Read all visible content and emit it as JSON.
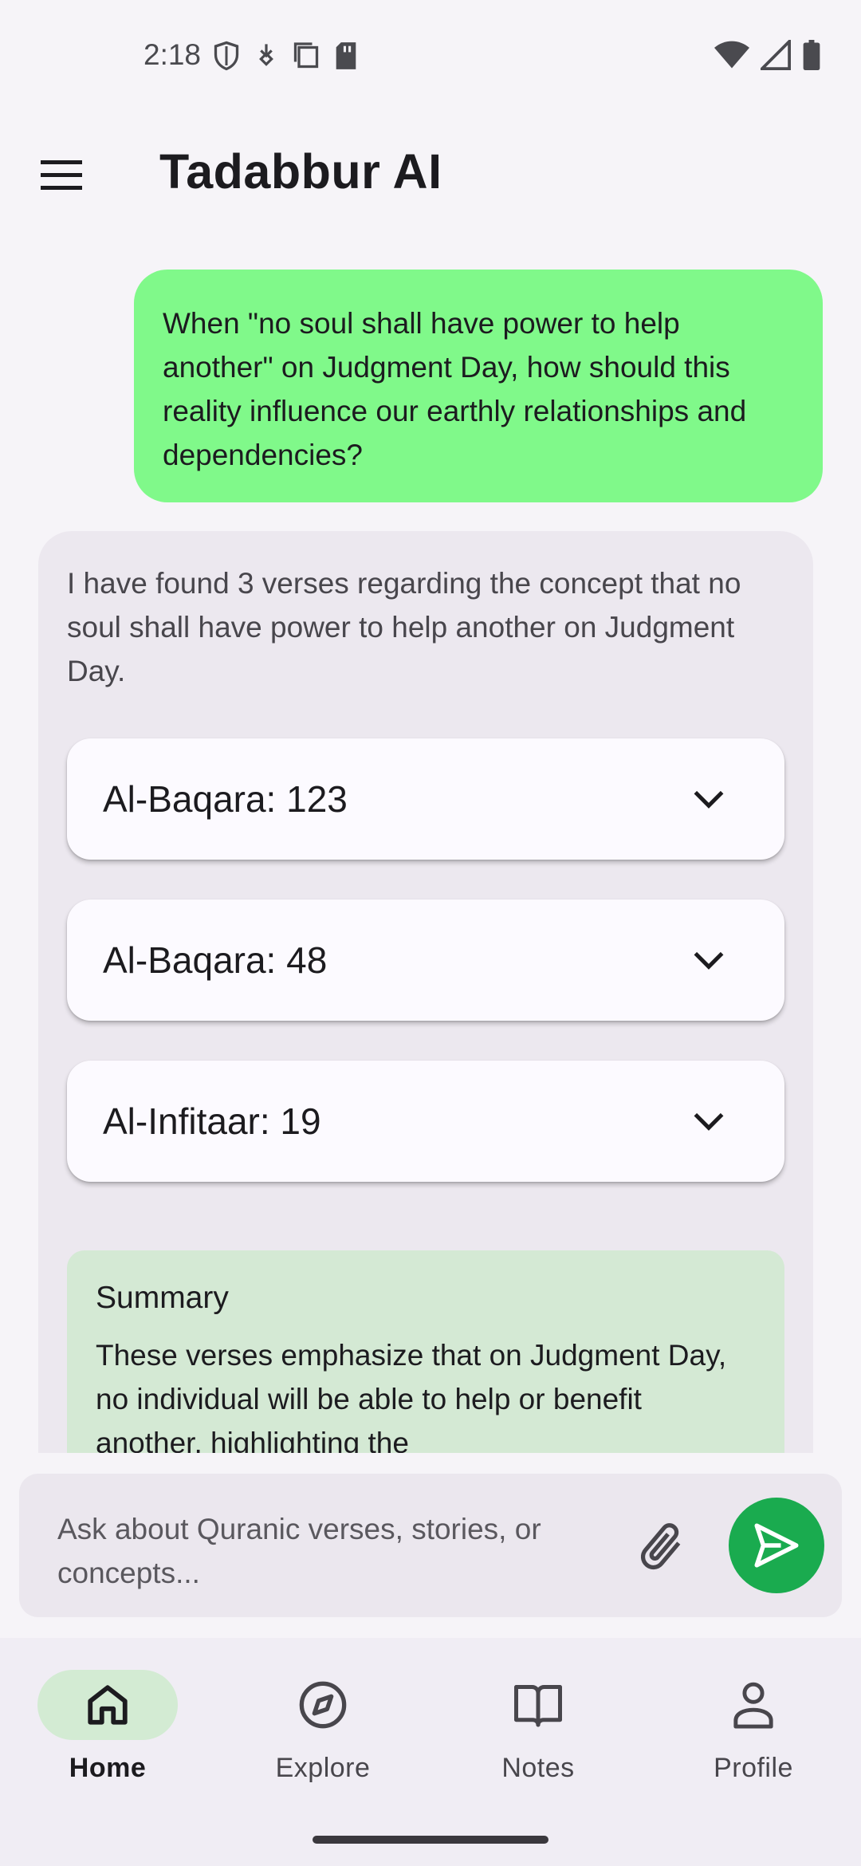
{
  "status_bar": {
    "time": "2:18",
    "left_icons": [
      "shield-icon",
      "download-icon",
      "copy-icon",
      "sd-card-icon"
    ],
    "right_icons": [
      "wifi-icon",
      "signal-icon",
      "battery-icon"
    ]
  },
  "app_bar": {
    "title": "Tadabbur AI",
    "menu_icon": "hamburger-menu-icon"
  },
  "chat": {
    "user_message": "When \"no soul shall have power to help another\" on Judgment Day, how should this reality influence our earthly relationships and dependencies?",
    "user_bubble_color": "#80f98a",
    "ai_intro": "I have found 3 verses regarding the concept that no soul shall have power to help another on Judgment Day.",
    "verses": [
      {
        "label": "Al-Baqara: 123"
      },
      {
        "label": "Al-Baqara: 48"
      },
      {
        "label": "Al-Infitaar: 19"
      }
    ],
    "summary": {
      "title": "Summary",
      "text": "These verses emphasize that on Judgment Day, no individual will be able to help or benefit another, highlighting the"
    }
  },
  "composer": {
    "placeholder": "Ask about Quranic verses, stories, or concepts...",
    "attach_icon": "paperclip-icon",
    "send_icon": "send-icon",
    "send_color": "#1aab4f"
  },
  "bottom_nav": {
    "items": [
      {
        "label": "Home",
        "icon": "home-icon",
        "active": true
      },
      {
        "label": "Explore",
        "icon": "compass-icon",
        "active": false
      },
      {
        "label": "Notes",
        "icon": "book-icon",
        "active": false
      },
      {
        "label": "Profile",
        "icon": "person-icon",
        "active": false
      }
    ],
    "active_color": "#d3ebd3"
  }
}
